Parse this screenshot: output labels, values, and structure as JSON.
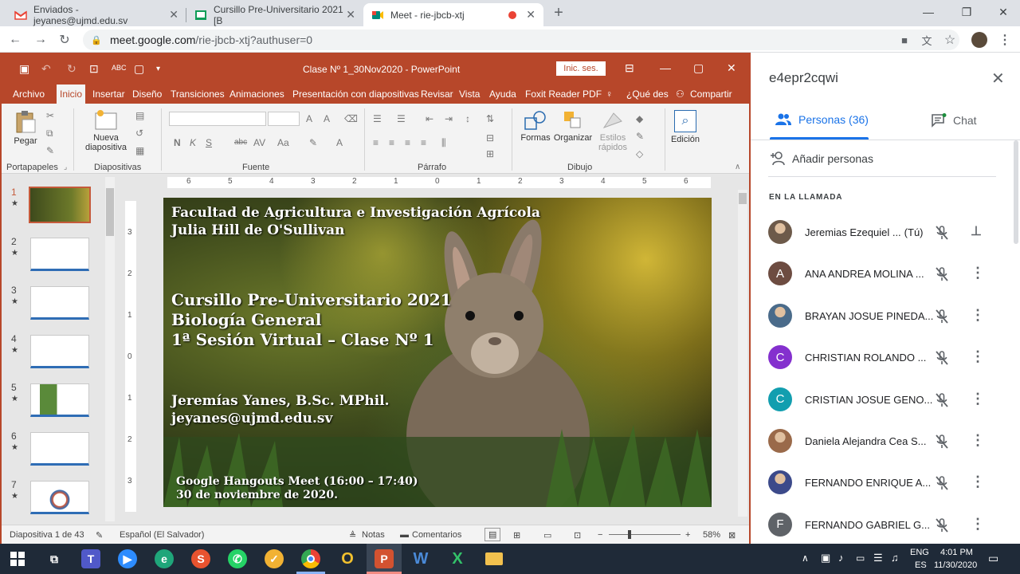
{
  "browser": {
    "tabs": [
      {
        "title": "Enviados - jeyanes@ujmd.edu.sv",
        "favicon": "gmail-icon"
      },
      {
        "title": "Cursillo Pre-Universitario 2021 [B",
        "favicon": "classroom-icon"
      },
      {
        "title": "Meet - rie-jbcb-xtj",
        "favicon": "meet-icon",
        "active": true
      }
    ],
    "url_host": "meet.google.com",
    "url_path": "/rie-jbcb-xtj?authuser=0"
  },
  "ppt": {
    "window_title": "Clase Nº 1_30Nov2020  -  PowerPoint",
    "signin_label": "Inic. ses.",
    "menus": [
      "Archivo",
      "Inicio",
      "Insertar",
      "Diseño",
      "Transiciones",
      "Animaciones",
      "Presentación con diapositivas",
      "Revisar",
      "Vista",
      "Ayuda",
      "Foxit Reader PDF",
      "¿Qué des",
      "Compartir"
    ],
    "ribbon": {
      "paste_label": "Pegar",
      "new_slide_label_1": "Nueva",
      "new_slide_label_2": "diapositiva",
      "shapes_label": "Formas",
      "arrange_label": "Organizar",
      "styles_label_1": "Estilos",
      "styles_label_2": "rápidos",
      "editing_label": "Edición",
      "font_buttons": [
        "N",
        "K",
        "S",
        "abc",
        "AV",
        "Aa"
      ],
      "groups": [
        "Portapapeles",
        "Diapositivas",
        "Fuente",
        "Párrafo",
        "Dibujo"
      ]
    },
    "thumb_numbers": [
      "1",
      "2",
      "3",
      "4",
      "5",
      "6",
      "7"
    ],
    "ruler_h": [
      "6",
      "5",
      "4",
      "3",
      "2",
      "1",
      "0",
      "1",
      "2",
      "3",
      "4",
      "5",
      "6"
    ],
    "ruler_v": [
      "3",
      "2",
      "1",
      "0",
      "1",
      "2",
      "3"
    ],
    "slide": {
      "line1": "Facultad de Agricultura e Investigación Agrícola",
      "line2": "Julia Hill de O'Sullivan",
      "line3": "Cursillo Pre-Universitario 2021",
      "line4": "Biología General",
      "line5": "1ª Sesión Virtual – Clase Nº 1",
      "line6": "Jeremías Yanes, B.Sc. MPhil.",
      "line7": "jeyanes@ujmd.edu.sv",
      "line8": "Google Hangouts Meet (16:00 – 17:40)",
      "line9": "30 de noviembre de 2020."
    },
    "status": {
      "slide_count": "Diapositiva 1 de 43",
      "language": "Español (El Salvador)",
      "notes": "Notas",
      "comments": "Comentarios",
      "zoom": "58%",
      "zoom_minus": "−",
      "zoom_plus": "+"
    }
  },
  "meet": {
    "meeting_code": "e4epr2cqwi",
    "tab_people": "Personas (36)",
    "tab_chat": "Chat",
    "add_people": "Añadir personas",
    "in_call_label": "EN LA LLAMADA",
    "people": [
      {
        "name": "Jeremias Ezequiel ...",
        "suffix": "(Tú)",
        "initial": "",
        "color": "#6d5a4a",
        "photo": true,
        "pin": true
      },
      {
        "name": "ANA ANDREA MOLINA ...",
        "initial": "A",
        "color": "#6d4c41",
        "photo": false
      },
      {
        "name": "BRAYAN JOSUE PINEDA...",
        "initial": "",
        "color": "#4a6b8a",
        "photo": true
      },
      {
        "name": "CHRISTIAN ROLANDO ...",
        "initial": "C",
        "color": "#8430ce",
        "photo": false
      },
      {
        "name": "CRISTIAN JOSUE GENO...",
        "initial": "C",
        "color": "#129eaf",
        "photo": false
      },
      {
        "name": "Daniela Alejandra Cea S...",
        "initial": "",
        "color": "#9a6a4a",
        "photo": true
      },
      {
        "name": "FERNANDO ENRIQUE A...",
        "initial": "",
        "color": "#3c4a8a",
        "photo": true
      },
      {
        "name": "FERNANDO GABRIEL G...",
        "initial": "F",
        "color": "#5f6368",
        "photo": false
      }
    ]
  },
  "taskbar": {
    "lang_1": "ENG",
    "lang_2": "ES",
    "time": "4:01 PM",
    "date": "11/30/2020"
  }
}
